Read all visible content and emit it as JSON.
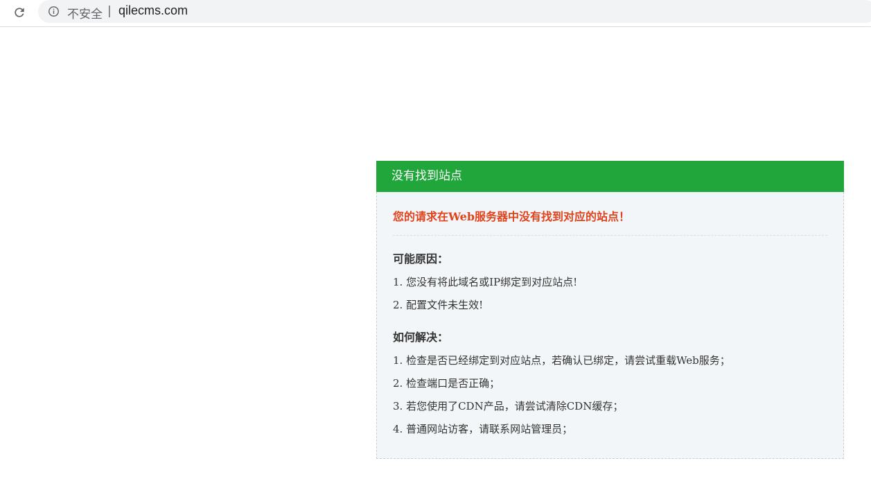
{
  "browser": {
    "security_label": "不安全",
    "separator": "|",
    "url": "qilecms.com"
  },
  "panel": {
    "title": "没有找到站点",
    "error_message": "您的请求在Web服务器中没有找到对应的站点！",
    "reasons_title": "可能原因：",
    "reasons": [
      "1. 您没有将此域名或IP绑定到对应站点!",
      "2. 配置文件未生效!"
    ],
    "solutions_title": "如何解决：",
    "solutions": [
      "1. 检查是否已经绑定到对应站点，若确认已绑定，请尝试重载Web服务；",
      "2. 检查端口是否正确；",
      "3. 若您使用了CDN产品，请尝试清除CDN缓存；",
      "4. 普通网站访客，请联系网站管理员；"
    ]
  },
  "colors": {
    "header_green": "#21a63b",
    "error_red": "#e0421b",
    "panel_bg": "#f2f6f8"
  },
  "icons": [
    "reload-icon",
    "info-icon"
  ]
}
